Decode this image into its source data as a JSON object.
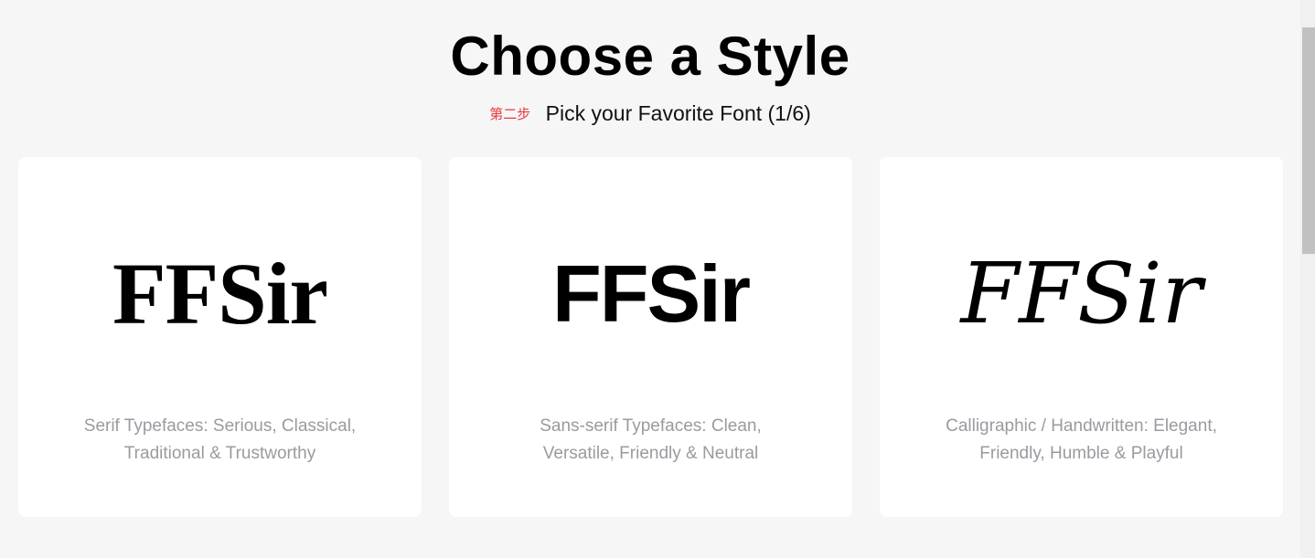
{
  "header": {
    "title": "Choose a Style",
    "step_tag": "第二步",
    "subtitle": "Pick your Favorite Font (1/6)"
  },
  "cards": [
    {
      "sample_text": "FFSir",
      "description": "Serif Typefaces: Serious, Classical, Traditional & Trustworthy"
    },
    {
      "sample_text": "FFSir",
      "description": "Sans-serif Typefaces: Clean, Versatile, Friendly & Neutral"
    },
    {
      "sample_text": "FFSir",
      "description": "Calligraphic / Handwritten: Elegant, Friendly, Humble & Playful"
    }
  ],
  "colors": {
    "background": "#f6f6f6",
    "card": "#ffffff",
    "step_tag": "#e8383d",
    "description": "#9a9aa0",
    "title": "#000000"
  }
}
